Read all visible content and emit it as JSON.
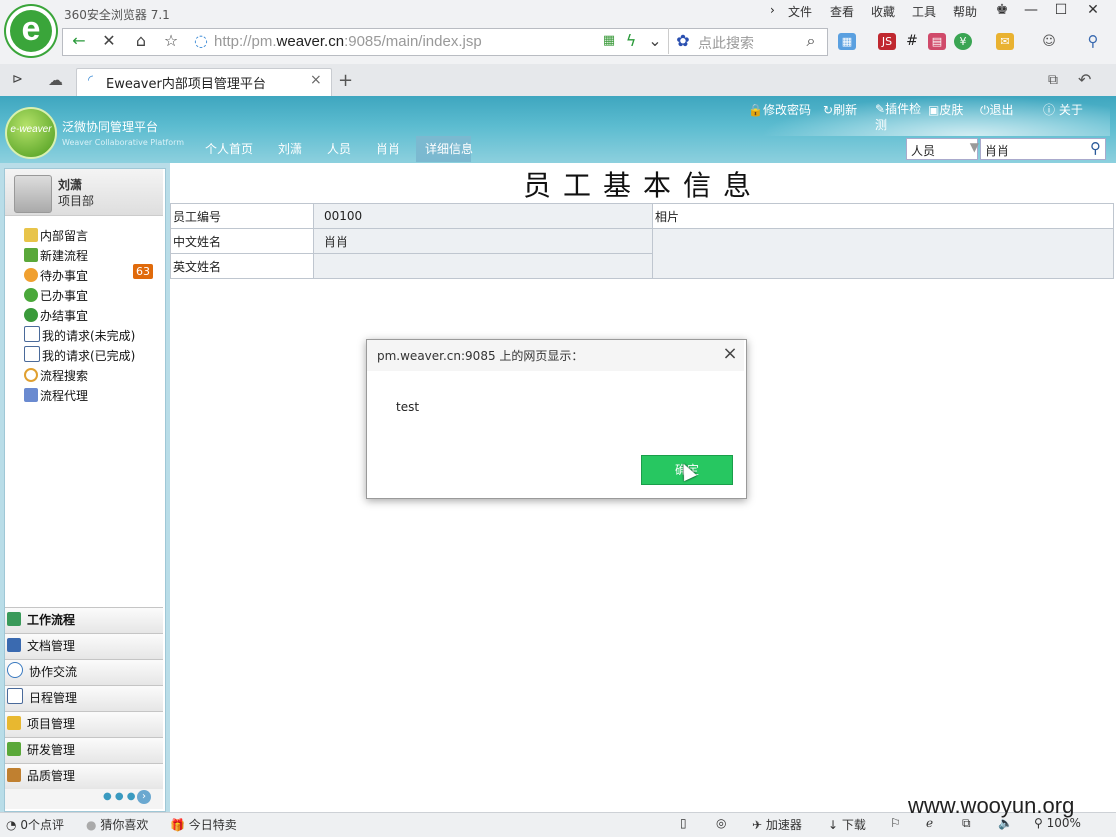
{
  "browser": {
    "title": "360安全浏览器 7.1",
    "logo_icon": "e-icon",
    "menu": [
      "文件",
      "查看",
      "收藏",
      "工具",
      "帮助"
    ],
    "url_prefix": "http://pm.",
    "url_host": "weaver.cn",
    "url_suffix": ":9085/main/index.jsp",
    "search_placeholder": "点此搜索",
    "tab_title": "Eweaver内部项目管理平台",
    "tab_close": "×",
    "new_tab": "+"
  },
  "app": {
    "logo_text": "e-weaver",
    "name": "泛微协同管理平台",
    "subtitle": "Weaver Collaborative Platform",
    "header_links": [
      "修改密码",
      "刷新",
      "插件检测",
      "皮肤",
      "退出",
      "关于"
    ],
    "tabs": [
      "个人首页",
      "刘潇",
      "人员",
      "肖肖",
      "详细信息"
    ],
    "search_select": "人员",
    "search_value": "肖肖"
  },
  "sidebar": {
    "user_name": "刘潇",
    "user_dept": "项目部",
    "links": [
      "内部留言",
      "新建流程",
      "待办事宜",
      "已办事宜",
      "办结事宜",
      "我的请求(未完成)",
      "我的请求(已完成)",
      "流程搜索",
      "流程代理"
    ],
    "pending_count": "63",
    "modules": [
      "工作流程",
      "文档管理",
      "协作交流",
      "日程管理",
      "项目管理",
      "研发管理",
      "品质管理"
    ]
  },
  "main": {
    "title": "员工基本信息",
    "rows": [
      {
        "label": "员工编号",
        "value": "00100"
      },
      {
        "label": "中文姓名",
        "value": "肖肖"
      },
      {
        "label": "英文姓名",
        "value": ""
      }
    ],
    "photo_label": "相片"
  },
  "dialog": {
    "title": "pm.weaver.cn:9085 上的网页显示：",
    "message": "test",
    "ok_label": "确定",
    "close": "×"
  },
  "status": {
    "comments": "0个点评",
    "guess": "猜你喜欢",
    "deals": "今日特卖",
    "accelerator": "加速器",
    "download": "下载",
    "zoom": "100%"
  },
  "watermark": "www.wooyun.org",
  "colors": {
    "header_blue": "#3ea6bf",
    "dialog_ok": "#27c761",
    "badge": "#e06a0b"
  }
}
